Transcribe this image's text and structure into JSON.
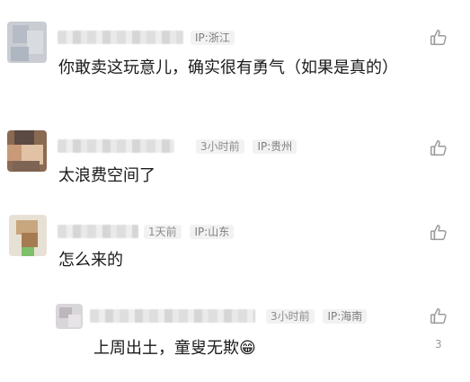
{
  "comments": [
    {
      "location": "IP:浙江",
      "text": "你敢卖这玩意儿，确实很有勇气（如果是真的）"
    },
    {
      "time": "3小时前",
      "location": "IP:贵州",
      "text": "太浪费空间了"
    },
    {
      "time": "1天前",
      "location": "IP:山东",
      "text": "怎么来的"
    },
    {
      "time": "3小时前",
      "location": "IP:海南",
      "text": "上周出土，童叟无欺😁",
      "likes": "3"
    }
  ],
  "colors": {
    "text": "#1a1a1a",
    "meta": "#8c8c8c",
    "chip_bg": "#f2f2f2",
    "icon": "#9a9a9a"
  },
  "icons": {
    "like": "thumbs-up-icon"
  }
}
